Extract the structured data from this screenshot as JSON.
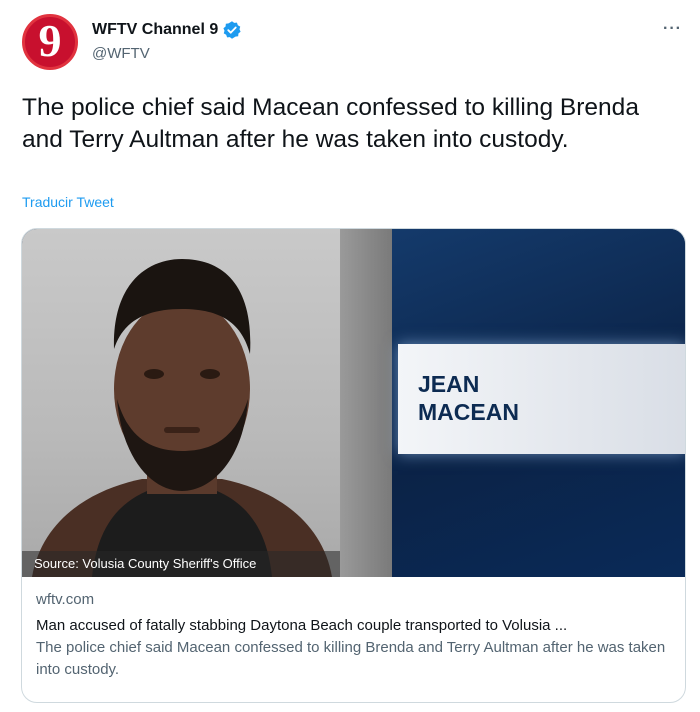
{
  "author": {
    "avatar_glyph": "9",
    "name": "WFTV Channel 9",
    "handle": "@WFTV",
    "verified": true
  },
  "tweet": {
    "text": "The police chief said Macean confessed to killing Brenda and Terry Aultman after he was taken into custody.",
    "translate_label": "Traducir Tweet",
    "more_icon": "···"
  },
  "card": {
    "image_name_line1": "JEAN",
    "image_name_line2": "MACEAN",
    "image_source": "Source: Volusia County Sheriff's Office",
    "domain": "wftv.com",
    "title": "Man accused of fatally stabbing Daytona Beach couple transported to Volusia ...",
    "description": "The police chief said Macean confessed to killing Brenda and Terry Aultman after he was taken into custody."
  },
  "colors": {
    "brand_red": "#c8102e",
    "link_blue": "#1d9bf0",
    "verified_blue": "#1d9bf0",
    "secondary_text": "#536471"
  }
}
